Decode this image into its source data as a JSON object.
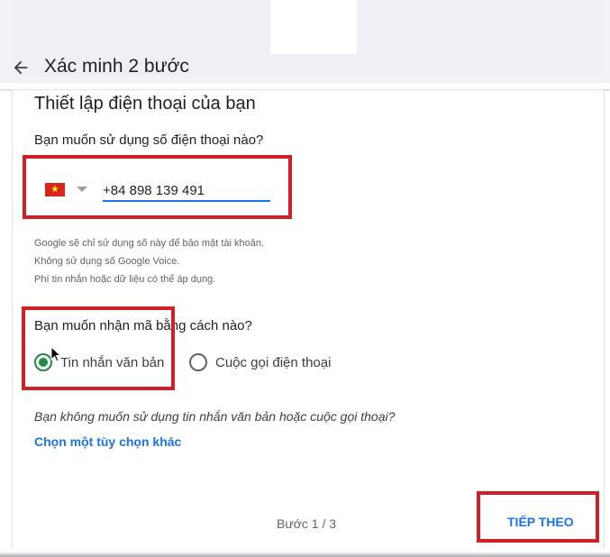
{
  "header": {
    "title": "Xác minh 2 bước"
  },
  "section": {
    "title": "Thiết lập điện thoại của bạn"
  },
  "phone": {
    "question": "Bạn muốn sử dụng số điện thoại nào?",
    "country_flag": "Vietnam flag",
    "value": "+84 898 139 491"
  },
  "help": {
    "lines": [
      "Google sẽ chỉ sử dụng số này để bảo mật tài khoản.",
      "Không sử dụng số Google Voice.",
      "Phí tin nhắn hoặc dữ liệu có thể áp dụng."
    ]
  },
  "method": {
    "question": "Bạn muốn nhận mã bằng cách nào?",
    "options": [
      {
        "label": "Tin nhắn văn bản",
        "selected": true
      },
      {
        "label": "Cuộc gọi điện thoại",
        "selected": false
      }
    ]
  },
  "alternative": {
    "question": "Bạn không muốn sử dụng tin nhắn văn bản hoặc cuộc gọi thoại?",
    "link": "Chọn một tùy chọn khác"
  },
  "footer": {
    "step": "Bước 1 / 3",
    "next_label": "TIẾP THEO"
  },
  "colors": {
    "accent": "#1a73e8",
    "radio_selected": "#1e8e3e",
    "highlight": "#d01f26",
    "flag_red": "#da251d",
    "flag_star": "#ffff00"
  }
}
